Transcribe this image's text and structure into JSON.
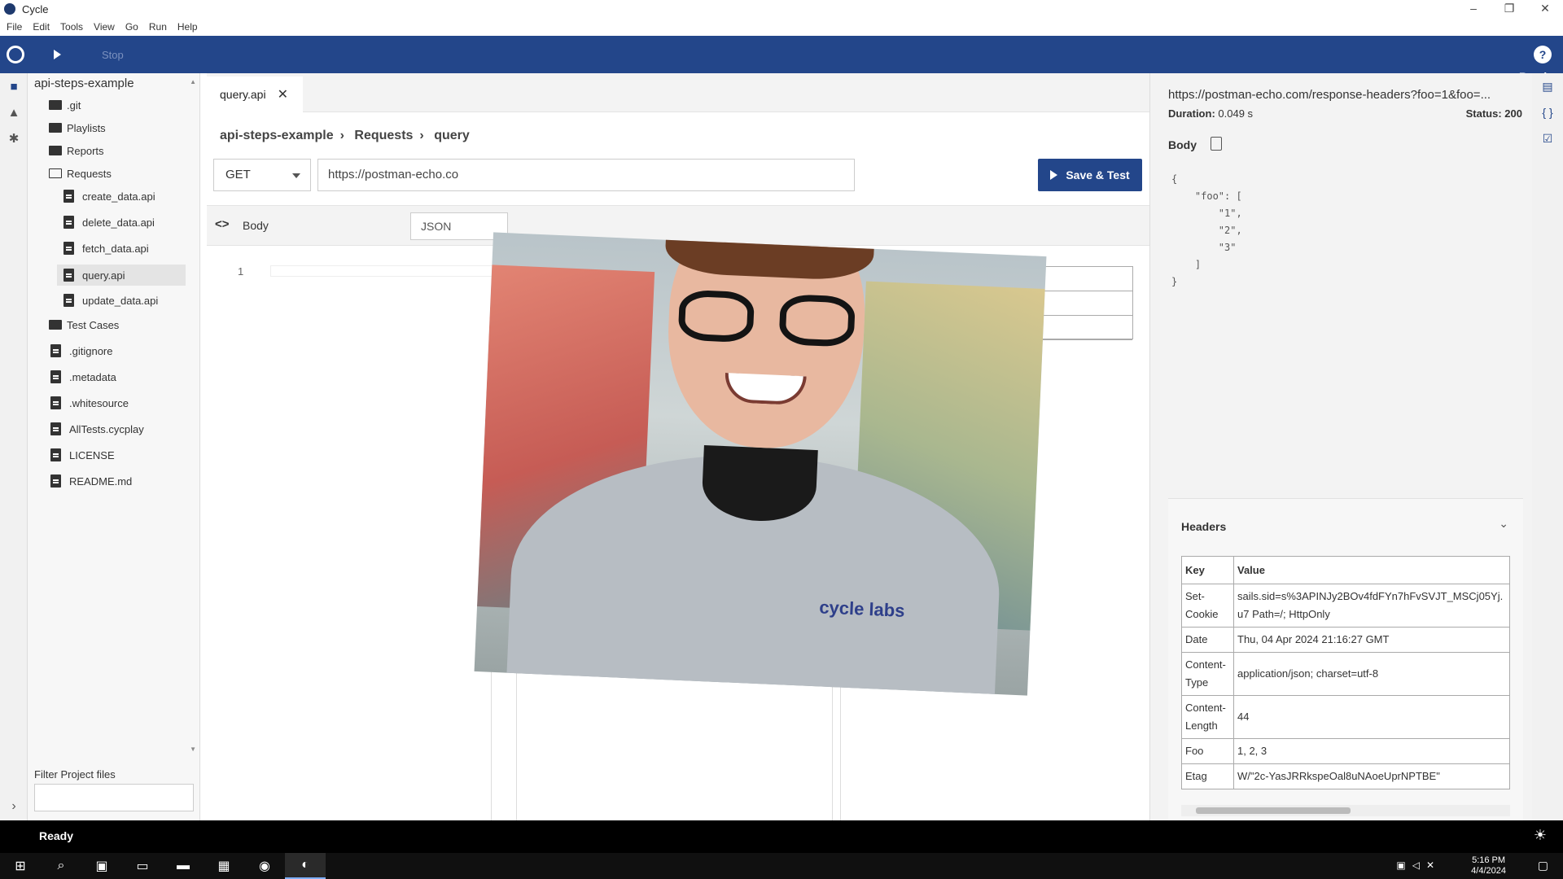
{
  "window": {
    "title": "Cycle",
    "controls": [
      "–",
      "❐",
      "✕"
    ]
  },
  "menu": [
    "File",
    "Edit",
    "Tools",
    "View",
    "Go",
    "Run",
    "Help"
  ],
  "toolbar": {
    "status": "Ready",
    "stop_label": "Stop",
    "help": "?"
  },
  "sidebar": {
    "root": "api-steps-example",
    "items": [
      {
        "label": ".git",
        "type": "folder"
      },
      {
        "label": "Playlists",
        "type": "folder"
      },
      {
        "label": "Reports",
        "type": "folder"
      },
      {
        "label": "Requests",
        "type": "folder-open"
      },
      {
        "label": "create_data.api",
        "type": "file"
      },
      {
        "label": "delete_data.api",
        "type": "file"
      },
      {
        "label": "fetch_data.api",
        "type": "file"
      },
      {
        "label": "query.api",
        "type": "file",
        "selected": true
      },
      {
        "label": "update_data.api",
        "type": "file"
      },
      {
        "label": "Test Cases",
        "type": "folder"
      },
      {
        "label": ".gitignore",
        "type": "file"
      },
      {
        "label": ".metadata",
        "type": "file"
      },
      {
        "label": ".whitesource",
        "type": "file"
      },
      {
        "label": "AllTests.cycplay",
        "type": "file"
      },
      {
        "label": "LICENSE",
        "type": "file"
      },
      {
        "label": "README.md",
        "type": "file"
      }
    ],
    "filter_label": "Filter Project files",
    "filter_value": ""
  },
  "editor": {
    "tab": "query.api",
    "breadcrumb": [
      "api-steps-example",
      "Requests",
      "query"
    ],
    "method": "GET",
    "url": "https://postman-echo.co",
    "save_test": "Save & Test",
    "body_label": "Body",
    "body_format": "JSON",
    "line_number": "1"
  },
  "webcam": {
    "logo_text": "cycle labs"
  },
  "response": {
    "url": "https://postman-echo.com/response-headers?foo=1&foo=...",
    "duration_label": "Duration:",
    "duration": "0.049 s",
    "status_label": "Status:",
    "status": "200",
    "body_label": "Body",
    "body_json": "{\n    \"foo\": [\n        \"1\",\n        \"2\",\n        \"3\"\n    ]\n}",
    "headers_title": "Headers",
    "headers_columns": [
      "Key",
      "Value"
    ],
    "headers": [
      {
        "key": "Set-Cookie",
        "value": "sails.sid=s%3APINJy2BOv4fdFYn7hFvSVJT_MSCj05Yj.u7 Path=/; HttpOnly"
      },
      {
        "key": "Date",
        "value": "Thu, 04 Apr 2024 21:16:27 GMT"
      },
      {
        "key": "Content-Type",
        "value": "application/json; charset=utf-8"
      },
      {
        "key": "Content-Length",
        "value": "44"
      },
      {
        "key": "Foo",
        "value": "1, 2, 3"
      },
      {
        "key": "Etag",
        "value": "W/\"2c-YasJRRkspeOal8uNAoeUprNPTBE\""
      }
    ]
  },
  "appstatus": {
    "text": "Ready"
  },
  "taskbar": {
    "time": "5:16 PM",
    "date": "4/4/2024"
  }
}
